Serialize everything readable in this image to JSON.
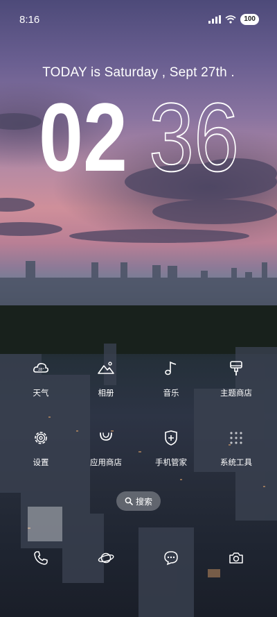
{
  "status_bar": {
    "time": "8:16",
    "battery": "100",
    "icons": [
      "signal-icon",
      "wifi-icon",
      "battery-icon"
    ]
  },
  "widget": {
    "today_text": "TODAY is Saturday , Sept 27th .",
    "hour": "02",
    "minute": "36"
  },
  "apps_row1": [
    {
      "label": "天气",
      "icon": "weather-cloud-icon"
    },
    {
      "label": "相册",
      "icon": "mountain-icon"
    },
    {
      "label": "音乐",
      "icon": "music-note-icon"
    },
    {
      "label": "主题商店",
      "icon": "brush-icon"
    }
  ],
  "apps_row2": [
    {
      "label": "设置",
      "icon": "gear-icon"
    },
    {
      "label": "应用商店",
      "icon": "bag-icon"
    },
    {
      "label": "手机管家",
      "icon": "shield-plus-icon"
    },
    {
      "label": "系统工具",
      "icon": "grid-dots-icon"
    }
  ],
  "search": {
    "label": "搜索",
    "icon": "search-icon"
  },
  "dock": [
    {
      "icon": "phone-icon"
    },
    {
      "icon": "planet-browser-icon"
    },
    {
      "icon": "message-bubble-icon"
    },
    {
      "icon": "camera-icon"
    }
  ]
}
